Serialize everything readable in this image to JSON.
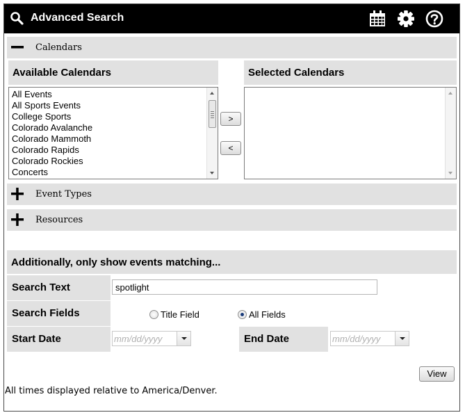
{
  "header": {
    "title": "Advanced Search",
    "icons": [
      "search-icon",
      "calendar-icon",
      "gear-icon",
      "help-icon"
    ]
  },
  "sections": {
    "calendars": {
      "label": "Calendars",
      "state": "expanded"
    },
    "event_types": {
      "label": "Event Types",
      "state": "collapsed"
    },
    "resources": {
      "label": "Resources",
      "state": "collapsed"
    }
  },
  "available": {
    "heading": "Available Calendars",
    "items": [
      "All Events",
      "All Sports Events",
      "College Sports",
      "Colorado Avalanche",
      "Colorado Mammoth",
      "Colorado Rapids",
      "Colorado Rockies",
      "Concerts"
    ]
  },
  "selected": {
    "heading": "Selected Calendars",
    "items": []
  },
  "move_buttons": {
    "add": ">",
    "remove": "<"
  },
  "filters": {
    "heading": "Additionally, only show events matching...",
    "search_text_label": "Search Text",
    "search_text_value": "spotlight",
    "search_fields_label": "Search Fields",
    "field_options": [
      "Title Field",
      "All Fields"
    ],
    "selected_field": "All Fields",
    "start_date_label": "Start Date",
    "end_date_label": "End Date",
    "date_placeholder": "mm/dd/yyyy"
  },
  "view_button": "View",
  "footer_note": "All times displayed relative to America/Denver.",
  "colors": {
    "header_bg": "#000000",
    "band_bg": "#e1e1e1",
    "radio_dot": "#1a3b7a"
  }
}
